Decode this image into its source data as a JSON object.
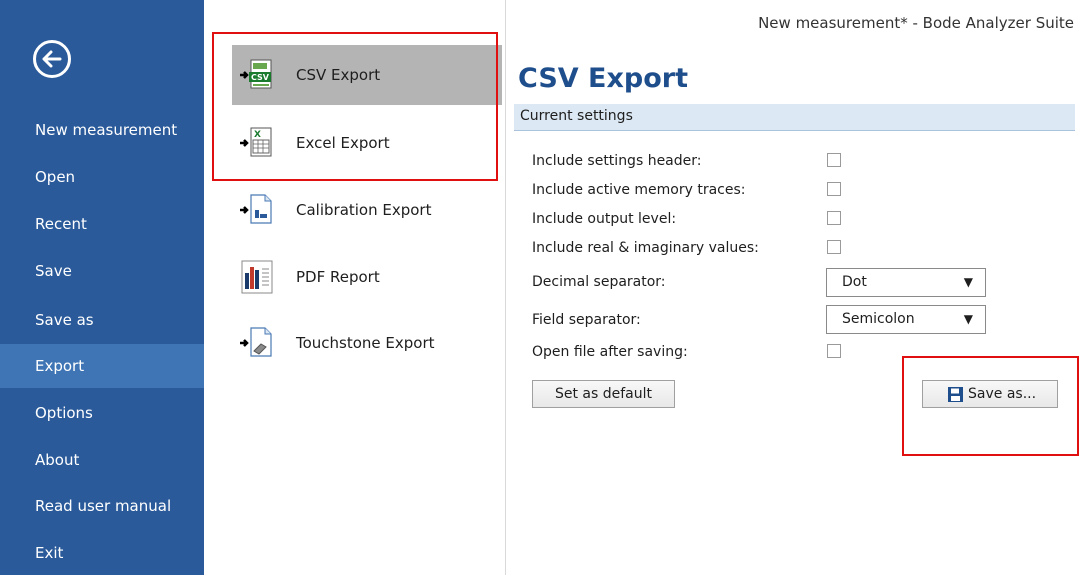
{
  "window": {
    "title": "New measurement* - Bode Analyzer Suite"
  },
  "sidebar": {
    "back_icon": "back-arrow-icon",
    "items": [
      {
        "label": "New measurement"
      },
      {
        "label": "Open"
      },
      {
        "label": "Recent"
      },
      {
        "label": "Save"
      },
      {
        "label": "Save as"
      },
      {
        "label": "Export",
        "active": true
      },
      {
        "label": "Options"
      },
      {
        "label": "About"
      },
      {
        "label": "Read user manual"
      },
      {
        "label": "Exit"
      }
    ]
  },
  "exports": {
    "items": [
      {
        "label": "CSV Export",
        "icon": "csv-export-icon",
        "selected": true
      },
      {
        "label": "Excel Export",
        "icon": "excel-export-icon"
      },
      {
        "label": "Calibration Export",
        "icon": "calibration-export-icon"
      },
      {
        "label": "PDF Report",
        "icon": "pdf-report-icon"
      },
      {
        "label": "Touchstone Export",
        "icon": "touchstone-export-icon"
      }
    ]
  },
  "panel": {
    "title": "CSV Export",
    "section": "Current settings",
    "settings": {
      "settings_header": {
        "label": "Include settings header:",
        "checked": false
      },
      "memory_traces": {
        "label": "Include active memory traces:",
        "checked": false
      },
      "output_level": {
        "label": "Include output level:",
        "checked": false
      },
      "real_imag": {
        "label": "Include real & imaginary values:",
        "checked": false
      },
      "decimal_separator": {
        "label": "Decimal separator:",
        "value": "Dot"
      },
      "field_separator": {
        "label": "Field separator:",
        "value": "Semicolon"
      },
      "open_after": {
        "label": "Open file after saving:",
        "checked": false
      }
    },
    "set_default_label": "Set as default",
    "save_as_label": "Save as...",
    "save_icon": "floppy-disk-icon"
  },
  "colors": {
    "sidebar": "#2a5a9a",
    "sidebar_active": "#3f75b5",
    "title": "#1f4e8c",
    "highlight_box": "#e01010"
  }
}
